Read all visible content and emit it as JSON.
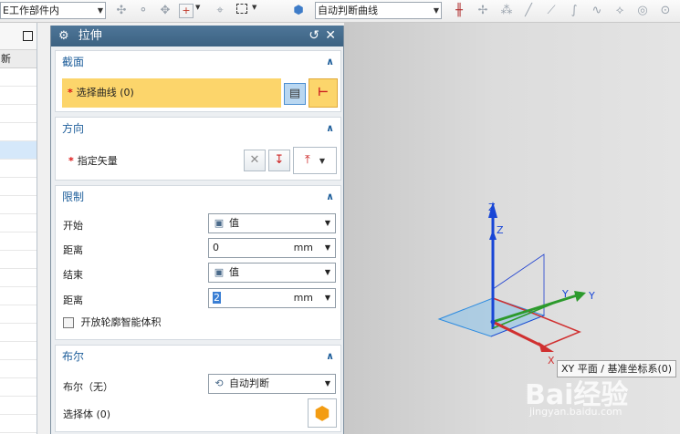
{
  "toolbar": {
    "scope_value": "E工作部件内",
    "curve_rule_value": "自动判断曲线",
    "icons": [
      "select-filter-icon",
      "select-similar-icon",
      "snap-icon",
      "snap-point-icon",
      "magnet-icon",
      "selection-box-icon",
      "solid-cube-icon",
      "intersection-icon",
      "move-node-icon",
      "diagonal-line-icon",
      "line-icon",
      "curve-icon",
      "spline-icon",
      "arc-icon",
      "circle-icon",
      "point-icon"
    ]
  },
  "navigator": {
    "column_header": "新",
    "selected_row": 5
  },
  "dialog": {
    "title": "拉伸",
    "section": {
      "title": "截面",
      "select_curve": "选择曲线 (0)"
    },
    "direction": {
      "title": "方向",
      "vector_label": "指定矢量"
    },
    "limits": {
      "title": "限制",
      "start_label": "开始",
      "start_value": "值",
      "distance1_label": "距离",
      "distance1_value": "0",
      "distance1_unit": "mm",
      "end_label": "结束",
      "end_value": "值",
      "distance2_label": "距离",
      "distance2_value": "2",
      "distance2_unit": "mm",
      "open_profile_label": "开放轮廓智能体积",
      "open_profile_checked": false
    },
    "boolean": {
      "title": "布尔",
      "label": "布尔（无）",
      "value": "自动判断",
      "select_body": "选择体 (0)"
    }
  },
  "viewport": {
    "axis_z_outer": "Z",
    "axis_z_inner": "Z",
    "axis_y_outer": "Y",
    "axis_y_inner": "Y",
    "axis_x": "X",
    "tooltip": "XY 平面 / 基准坐标系(0)",
    "watermark_brand": "Bai经验",
    "watermark_url": "jingyan.baidu.com",
    "colors": {
      "z_axis": "#1846d6",
      "y_axis": "#2c9a2c",
      "x_axis": "#d03030",
      "xy_plane_fill": "#8fc3e8",
      "accent_title": "#3c6282",
      "highlight": "#fcd56b"
    }
  }
}
